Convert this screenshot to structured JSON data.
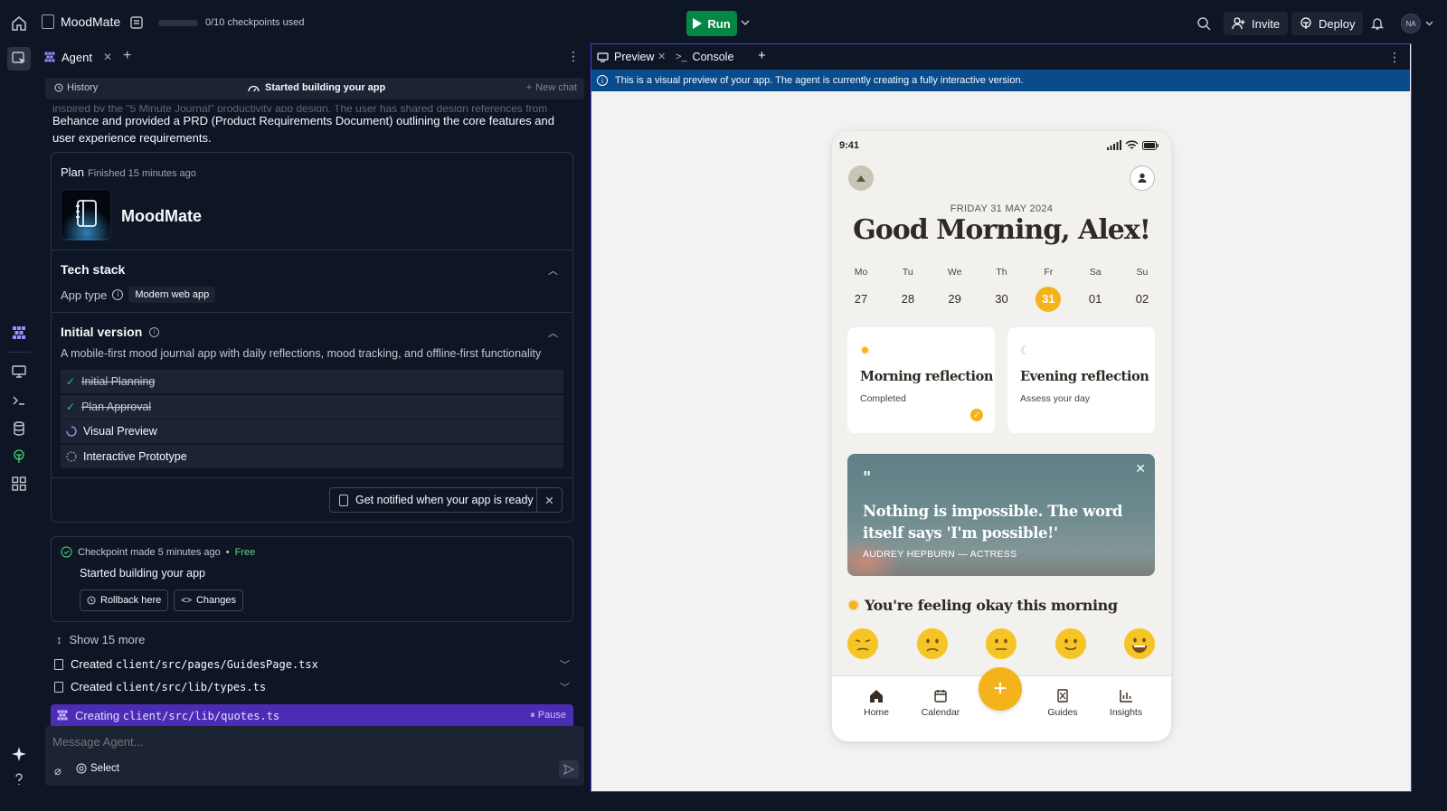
{
  "topbar": {
    "project_name": "MoodMate",
    "checkpoints": "0/10 checkpoints used",
    "checkpoint_progress": 0,
    "run_label": "Run",
    "invite_label": "Invite",
    "deploy_label": "Deploy",
    "avatar_initials": "NA"
  },
  "agent": {
    "tab_label": "Agent",
    "history_label": "History",
    "status_label": "Started building your app",
    "new_chat_label": "New chat",
    "intro_faded": "inspired by the \"5 Minute Journal\" productivity app design. The user has shared design references from",
    "intro_text": "Behance and provided a PRD (Product Requirements Document) outlining the core features and user experience requirements.",
    "plan": {
      "label": "Plan",
      "finished": "Finished 15 minutes ago",
      "app_name": "MoodMate",
      "tech_stack_title": "Tech stack",
      "app_type_label": "App type",
      "app_type_value": "Modern web app",
      "initial_version_title": "Initial version",
      "initial_version_desc": "A mobile-first mood journal app with daily reflections, mood tracking, and offline-first functionality",
      "steps": [
        {
          "label": "Initial Planning",
          "status": "done"
        },
        {
          "label": "Plan Approval",
          "status": "done"
        },
        {
          "label": "Visual Preview",
          "status": "in-progress"
        },
        {
          "label": "Interactive Prototype",
          "status": "pending"
        }
      ],
      "notify_label": "Get notified when your app is ready"
    },
    "checkpoint": {
      "made": "Checkpoint made 5 minutes ago",
      "free": "Free",
      "title": "Started building your app",
      "rollback_label": "Rollback here",
      "changes_label": "Changes"
    },
    "show_more": "Show 15 more",
    "created_files": [
      {
        "prefix": "Created",
        "path": "client/src/pages/GuidesPage.tsx"
      },
      {
        "prefix": "Created",
        "path": "client/src/lib/types.ts"
      }
    ],
    "creating": {
      "prefix": "Creating",
      "path": "client/src/lib/quotes.ts",
      "pause_label": "Pause"
    },
    "message_placeholder": "Message Agent...",
    "select_label": "Select"
  },
  "preview": {
    "tab_preview": "Preview",
    "tab_console": "Console",
    "banner": "This is a visual preview of your app. The agent is currently creating a fully interactive version.",
    "phone": {
      "time": "9:41",
      "date": "FRIDAY 31 MAY 2024",
      "greeting": "Good Morning, Alex!",
      "days": [
        {
          "name": "Mo",
          "num": "27"
        },
        {
          "name": "Tu",
          "num": "28"
        },
        {
          "name": "We",
          "num": "29"
        },
        {
          "name": "Th",
          "num": "30"
        },
        {
          "name": "Fr",
          "num": "31"
        },
        {
          "name": "Sa",
          "num": "01"
        },
        {
          "name": "Su",
          "num": "02"
        }
      ],
      "selected_day": 4,
      "morning_title": "Morning reflection",
      "morning_status": "Completed",
      "evening_title": "Evening reflection",
      "evening_status": "Assess your day",
      "quote_mark": "\"",
      "quote_text": "Nothing is impossible. The word itself says 'I'm possible!'",
      "quote_author": "AUDREY HEPBURN — ACTRESS",
      "feeling": "You're feeling okay this morning",
      "moods": [
        "very-sad",
        "sad",
        "neutral",
        "happy",
        "very-happy"
      ],
      "nav": {
        "home": "Home",
        "calendar": "Calendar",
        "guides": "Guides",
        "insights": "Insights"
      },
      "accent": "#f5b31b"
    }
  }
}
